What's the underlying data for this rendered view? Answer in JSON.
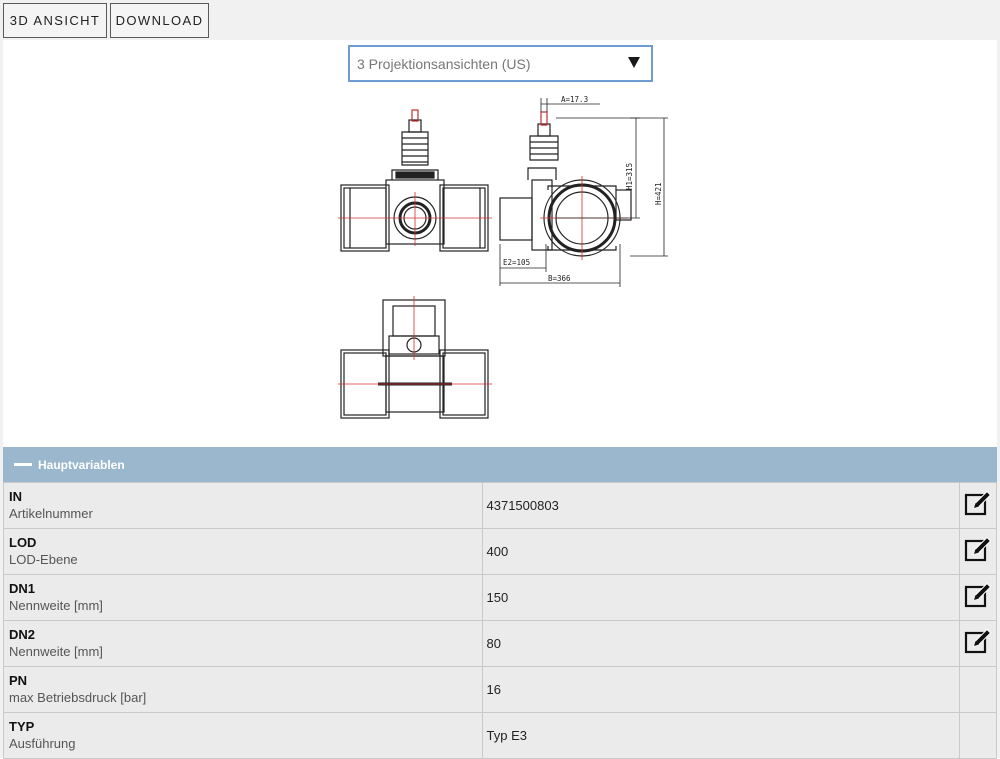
{
  "toolbar": {
    "view3d_label": "3D ANSICHT",
    "download_label": "DOWNLOAD"
  },
  "projection_select": {
    "selected": "3 Projektionsansichten (US)"
  },
  "drawing": {
    "dim_a": "A=17.3",
    "dim_h1": "H1=315",
    "dim_h": "H=421",
    "dim_e2": "E2=105",
    "dim_b": "B=366"
  },
  "section": {
    "title": "Hauptvariablen"
  },
  "rows": [
    {
      "key": "IN",
      "desc": "Artikelnummer",
      "value": "4371500803",
      "editable": true
    },
    {
      "key": "LOD",
      "desc": "LOD-Ebene",
      "value": "400",
      "editable": true
    },
    {
      "key": "DN1",
      "desc": "Nennweite [mm]",
      "value": "150",
      "editable": true
    },
    {
      "key": "DN2",
      "desc": "Nennweite [mm]",
      "value": "80",
      "editable": true
    },
    {
      "key": "PN",
      "desc": "max Betriebsdruck [bar]",
      "value": "16",
      "editable": false
    },
    {
      "key": "TYP",
      "desc": "Ausführung",
      "value": "Typ E3",
      "editable": false
    }
  ]
}
